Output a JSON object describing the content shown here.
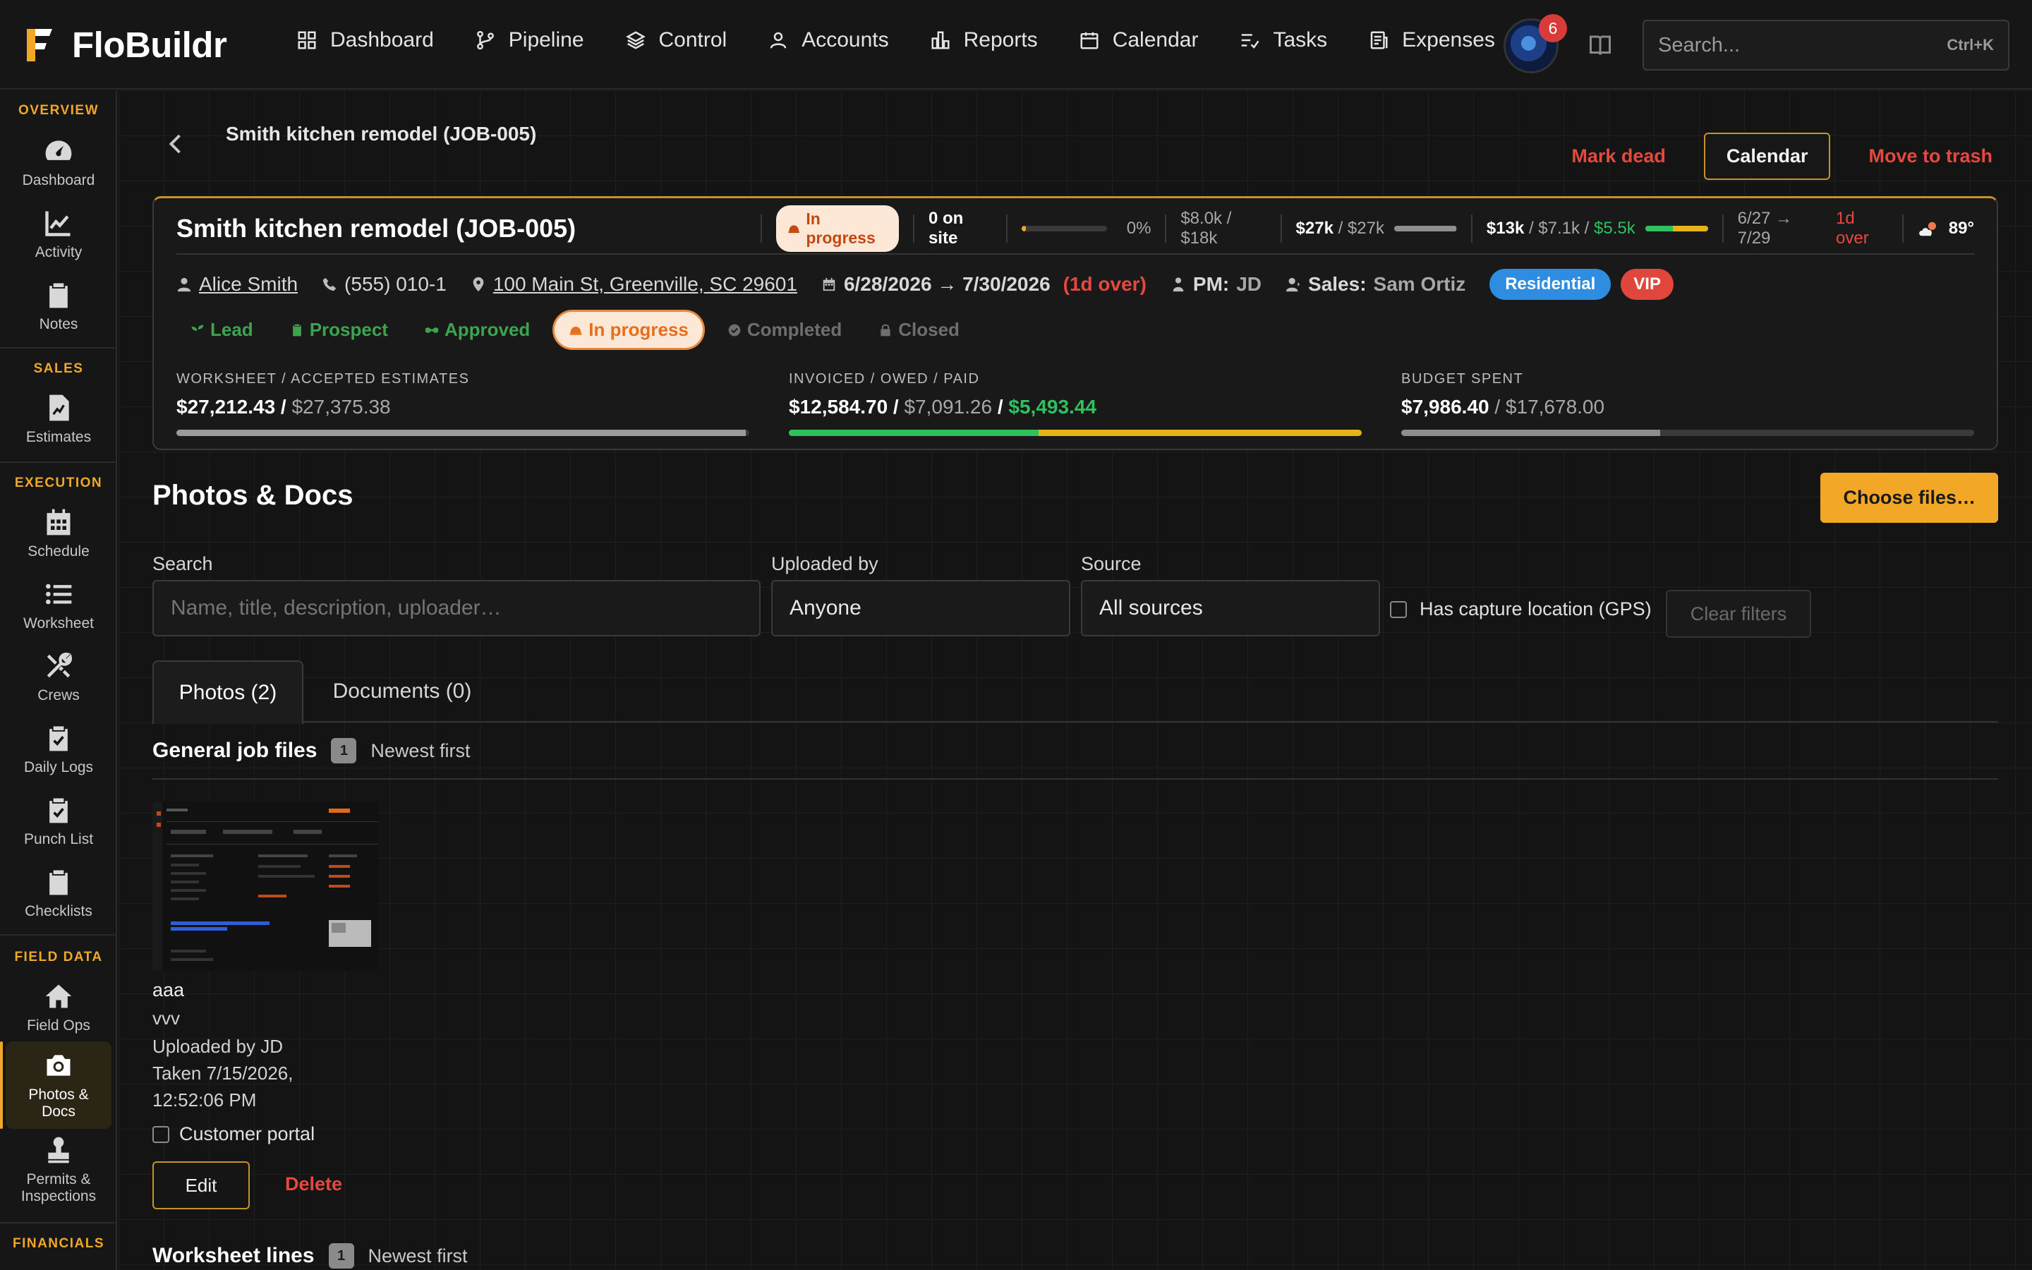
{
  "app": {
    "name": "FloBuildr"
  },
  "topnav": [
    {
      "label": "Dashboard",
      "icon": "grid-icon"
    },
    {
      "label": "Pipeline",
      "icon": "branch-icon"
    },
    {
      "label": "Control",
      "icon": "layers-icon"
    },
    {
      "label": "Accounts",
      "icon": "user-icon"
    },
    {
      "label": "Reports",
      "icon": "bar-chart-icon"
    },
    {
      "label": "Calendar",
      "icon": "calendar-icon"
    },
    {
      "label": "Tasks",
      "icon": "tasks-icon"
    },
    {
      "label": "Expenses",
      "icon": "receipt-icon"
    }
  ],
  "notifications": {
    "count": "6"
  },
  "search": {
    "placeholder": "Search...",
    "shortcut": "Ctrl+K"
  },
  "sidebar": {
    "sections": [
      "OVERVIEW",
      "SALES",
      "EXECUTION",
      "FIELD DATA",
      "FINANCIALS"
    ],
    "items": [
      {
        "label": "Dashboard",
        "icon": "gauge-icon"
      },
      {
        "label": "Activity",
        "icon": "activity-chart-icon"
      },
      {
        "label": "Notes",
        "icon": "clipboard-icon"
      },
      {
        "label": "Estimates",
        "icon": "estimate-file-icon"
      },
      {
        "label": "Schedule",
        "icon": "calendar-grid-icon"
      },
      {
        "label": "Worksheet",
        "icon": "list-icon"
      },
      {
        "label": "Crews",
        "icon": "tools-icon"
      },
      {
        "label": "Daily Logs",
        "icon": "clipboard-check-icon"
      },
      {
        "label": "Punch List",
        "icon": "clipboard-check-icon"
      },
      {
        "label": "Checklists",
        "icon": "clipboard-icon"
      },
      {
        "label": "Field Ops",
        "icon": "home-icon"
      },
      {
        "label": "Photos & Docs",
        "icon": "camera-icon"
      },
      {
        "label": "Permits & Inspections",
        "icon": "stamp-icon"
      }
    ]
  },
  "page": {
    "breadcrumb_title": "Smith kitchen remodel (JOB-005)",
    "actions": {
      "mark_dead": "Mark dead",
      "calendar": "Calendar",
      "trash": "Move to trash"
    }
  },
  "job": {
    "title": "Smith kitchen remodel (JOB-005)",
    "status": "In progress",
    "on_site": "0 on site",
    "progress_pct": "0%",
    "progress_value": 0.05,
    "budget_short": "$8.0k / $18k",
    "est_short_bold": "$27k",
    "est_short_rest": " / $27k",
    "est_fill": 0.99,
    "inv_short_bold": "$13k",
    "inv_short_owed": " / $7.1k / ",
    "inv_short_paid": "$5.5k",
    "inv_paid_fill": 0.44,
    "dates_short": "6/27 → 7/29",
    "over_short": "1d over",
    "temperature": "89°",
    "customer": "Alice Smith",
    "phone": "(555) 010-1",
    "address": "100 Main St, Greenville, SC 29601",
    "date_range": "6/28/2026 → 7/30/2026",
    "over_long": "(1d over)",
    "pm_label": "PM:",
    "pm": "JD",
    "sales_label": "Sales:",
    "sales": "Sam Ortiz",
    "tags": [
      "Residential",
      "VIP"
    ],
    "stages": [
      {
        "label": "Lead",
        "state": "done"
      },
      {
        "label": "Prospect",
        "state": "done"
      },
      {
        "label": "Approved",
        "state": "done"
      },
      {
        "label": "In progress",
        "state": "current"
      },
      {
        "label": "Completed",
        "state": "todo"
      },
      {
        "label": "Closed",
        "state": "todo"
      }
    ],
    "financials": {
      "worksheet": {
        "label": "WORKSHEET / ACCEPTED ESTIMATES",
        "primary": "$27,212.43",
        "sep": " / ",
        "secondary": "$27,375.38",
        "fill": 0.994
      },
      "invoiced": {
        "label": "INVOICED / OWED / PAID",
        "primary": "$12,584.70",
        "sep": " / ",
        "owed": "$7,091.26",
        "sep2": " / ",
        "paid": "$5,493.44",
        "paid_fill": 0.436
      },
      "budget": {
        "label": "BUDGET SPENT",
        "primary": "$7,986.40",
        "sep": " / ",
        "secondary": "$17,678.00",
        "fill": 0.452
      }
    }
  },
  "photos_docs": {
    "title": "Photos & Docs",
    "choose_files": "Choose files…",
    "filters": {
      "search_label": "Search",
      "search_placeholder": "Name, title, description, uploader…",
      "uploaded_by_label": "Uploaded by",
      "uploaded_by_value": "Anyone",
      "source_label": "Source",
      "source_value": "All sources",
      "gps_label": "Has capture location (GPS)",
      "clear": "Clear filters"
    },
    "tabs": [
      "Photos (2)",
      "Documents (0)"
    ],
    "groups": [
      {
        "title": "General job files",
        "count": "1",
        "sort": "Newest first"
      },
      {
        "title": "Worksheet lines",
        "count": "1",
        "sort": "Newest first"
      }
    ],
    "file": {
      "name": "aaa",
      "description": "vvv",
      "uploaded_by": "Uploaded by JD",
      "taken_line1": "Taken 7/15/2026,",
      "taken_line2": "12:52:06 PM",
      "portal_label": "Customer portal",
      "edit": "Edit",
      "delete": "Delete"
    }
  },
  "colors": {
    "accent": "#f2a726",
    "danger": "#e5483f",
    "success": "#2fc15e",
    "background": "#141414"
  }
}
